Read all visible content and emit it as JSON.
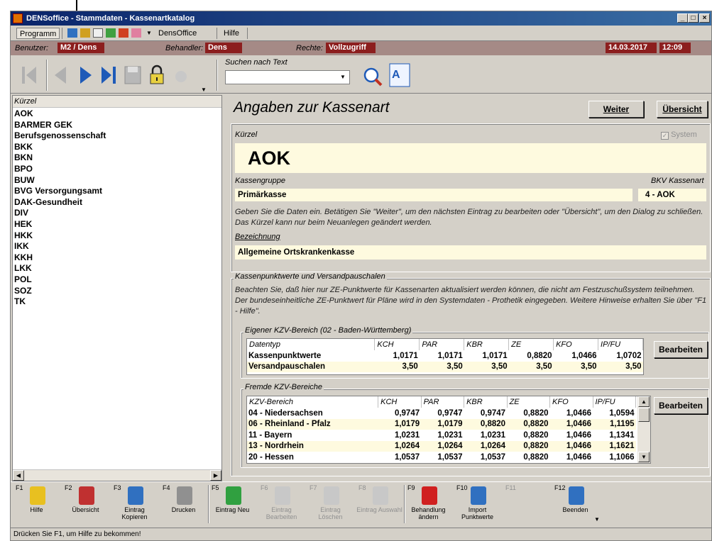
{
  "window": {
    "title": "DENSoffice - Stammdaten - Kassenartkatalog",
    "controls": [
      "_",
      "□",
      "×"
    ]
  },
  "menu": {
    "programm": "Programm",
    "densoffice": "DensOffice",
    "hilfe": "Hilfe"
  },
  "userbar": {
    "benutzer_label": "Benutzer:",
    "benutzer_value": "M2 / Dens",
    "behandler_label": "Behandler:",
    "behandler_value": "Dens",
    "rechte_label": "Rechte:",
    "rechte_value": "Vollzugriff",
    "date": "14.03.2017",
    "time": "12:09"
  },
  "toolbar": {
    "search_label": "Suchen nach Text",
    "search_value": ""
  },
  "list": {
    "header": "Kürzel",
    "items": [
      "AOK",
      "BARMER GEK",
      "Berufsgenossenschaft",
      "BKK",
      "BKN",
      "BPO",
      "BUW",
      "BVG Versorgungsamt",
      "DAK-Gesundheit",
      "DIV",
      "HEK",
      "HKK",
      "IKK",
      "KKH",
      "LKK",
      "POL",
      "SOZ",
      "TK"
    ]
  },
  "main": {
    "title": "Angaben zur Kassenart",
    "weiter_label": "Weiter",
    "uebersicht_label": "Übersicht",
    "kuerzel_label": "Kürzel",
    "system_label": "System",
    "kuerzel_value": "AOK",
    "kassengruppe_label": "Kassengruppe",
    "kassengruppe_value": "Primärkasse",
    "bkv_label": "BKV Kassenart",
    "bkv_value": "4 - AOK",
    "hint": "Geben Sie die Daten ein. Betätigen Sie \"Weiter\", um den nächsten Eintrag zu bearbeiten oder \"Übersicht\", um den Dialog zu schließen. Das Kürzel kann nur beim Neuanlegen geändert werden.",
    "bezeichnung_label": "Bezeichnung",
    "bezeichnung_value": "Allgemeine Ortskrankenkasse",
    "punkt_group": "Kassenpunktwerte und Versandpauschalen",
    "punkt_hint": "Beachten Sie, daß hier nur ZE-Punktwerte für Kassenarten aktualisiert werden können, die nicht am Festzuschußsystem teilnehmen. Der bundeseinheitliche ZE-Punktwert für Pläne wird in den Systemdaten - Prothetik eingegeben. Weitere Hinweise erhalten Sie über \"F1 - Hilfe\".",
    "eigener_group": "Eigener KZV-Bereich (02 - Baden-Württemberg)",
    "eigener_headers": [
      "Datentyp",
      "KCH",
      "PAR",
      "KBR",
      "ZE",
      "KFO",
      "IP/FU"
    ],
    "eigener_rows": [
      [
        "Kassenpunktwerte",
        "1,0171",
        "1,0171",
        "1,0171",
        "0,8820",
        "1,0466",
        "1,0702"
      ],
      [
        "Versandpauschalen",
        "3,50",
        "3,50",
        "3,50",
        "3,50",
        "3,50",
        "3,50"
      ]
    ],
    "bearbeiten_label": "Bearbeiten",
    "fremde_group": "Fremde KZV-Bereiche",
    "fremde_headers": [
      "KZV-Bereich",
      "KCH",
      "PAR",
      "KBR",
      "ZE",
      "KFO",
      "IP/FU"
    ],
    "fremde_rows": [
      [
        "04 - Niedersachsen",
        "0,9747",
        "0,9747",
        "0,9747",
        "0,8820",
        "1,0466",
        "1,0594"
      ],
      [
        "06 - Rheinland - Pfalz",
        "1,0179",
        "1,0179",
        "0,8820",
        "0,8820",
        "1,0466",
        "1,1195"
      ],
      [
        "11 - Bayern",
        "1,0231",
        "1,0231",
        "1,0231",
        "0,8820",
        "1,0466",
        "1,1341"
      ],
      [
        "13 - Nordrhein",
        "1,0264",
        "1,0264",
        "1,0264",
        "0,8820",
        "1,0466",
        "1,1621"
      ],
      [
        "20 - Hessen",
        "1,0537",
        "1,0537",
        "1,0537",
        "0,8820",
        "1,0466",
        "1,1066"
      ]
    ]
  },
  "fkeys": [
    {
      "key": "F1",
      "label": "Hilfe",
      "icon": "help-icon"
    },
    {
      "key": "F2",
      "label": "Übersicht",
      "icon": "person-icon"
    },
    {
      "key": "F3",
      "label": "Eintrag Kopieren",
      "icon": "copy-icon"
    },
    {
      "key": "F4",
      "label": "Drucken",
      "icon": "printer-icon"
    },
    {
      "key": "F5",
      "label": "Eintrag Neu",
      "icon": "new-entry-icon"
    },
    {
      "key": "F6",
      "label": "Eintrag Bearbeiten",
      "icon": "edit-icon"
    },
    {
      "key": "F7",
      "label": "Eintrag Löschen",
      "icon": "delete-icon"
    },
    {
      "key": "F8",
      "label": "Eintrag Auswahl",
      "icon": "select-icon"
    },
    {
      "key": "F9",
      "label": "Behandlung ändern",
      "icon": "tooth-icon"
    },
    {
      "key": "F10",
      "label": "Import Punktwerte",
      "icon": "import-icon"
    },
    {
      "key": "F11",
      "label": "",
      "icon": ""
    },
    {
      "key": "F12",
      "label": "Beenden",
      "icon": "exit-icon"
    }
  ],
  "status": "Drücken Sie F1, um Hilfe zu bekommen!",
  "colors": {
    "titlebar": "#0a246a",
    "userbar": "#a58a86",
    "accent_red": "#8c1e1e",
    "row_highlight": "#fefadf"
  }
}
